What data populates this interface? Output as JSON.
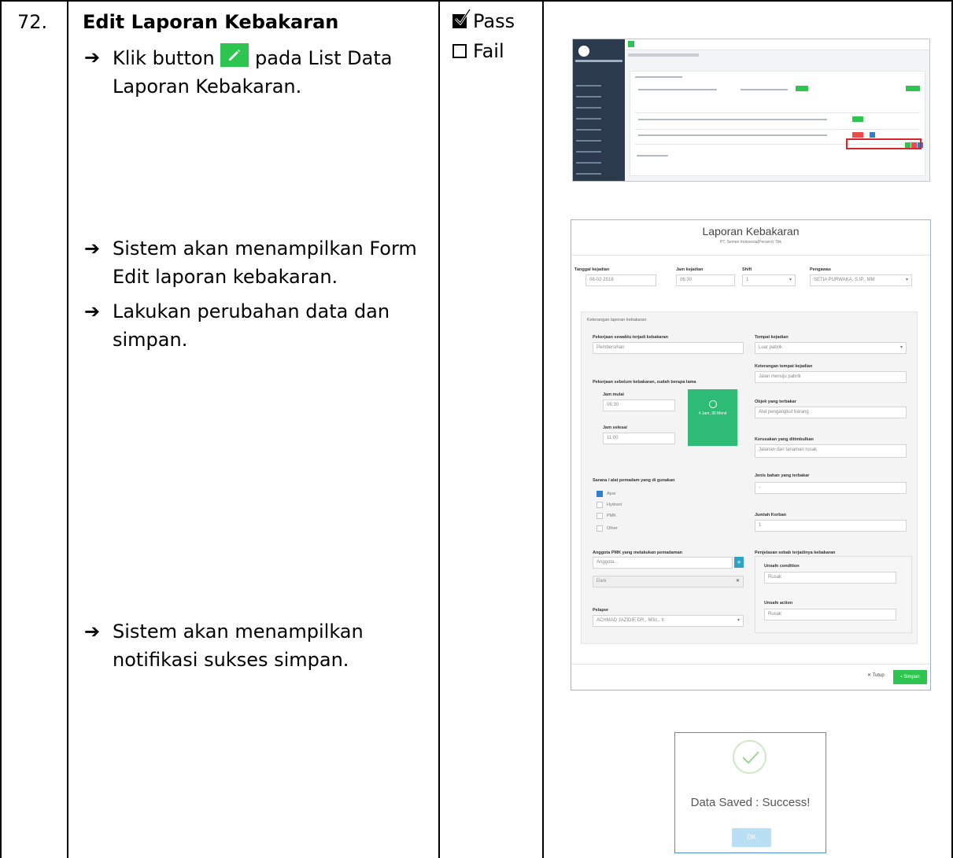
{
  "row": {
    "number": "72.",
    "title": "Edit Laporan Kebakaran",
    "steps": [
      {
        "text_before": "Klik button",
        "text_after": "pada List Data Laporan Kebakaran.",
        "icon": "pencil-icon"
      },
      {
        "text": "Sistem akan menampilkan Form Edit laporan kebakaran."
      },
      {
        "text": "Lakukan perubahan data dan simpan."
      },
      {
        "text": "Sistem akan menampilkan notifikasi sukses simpan."
      }
    ],
    "result": {
      "pass_label": "Pass",
      "fail_label": "Fail",
      "pass_checked": true,
      "fail_checked": false
    }
  },
  "form": {
    "title": "Laporan Kebakaran",
    "subtitle": "PT. Semen Indonesia(Persero) Tbk",
    "fields": {
      "tanggal_label": "Tanggal kejadian",
      "tanggal_value": "08-02-2018",
      "jam_label": "Jam kejadian",
      "jam_value": "06:30",
      "shift_label": "Shift",
      "shift_value": "1",
      "pengawas_label": "Pengawas",
      "pengawas_value": "SETIA PURWAKA, S.IP., MM"
    },
    "section_title": "Keterangan laporan kebakaran",
    "pekerjaan_label": "Pekerjaan sewaktu terjadi kebakaran",
    "pekerjaan_value": "Pembersihan",
    "sebelum_label": "Pekerjaan sebelum kebakaran, sudah berapa lama",
    "jam_mulai_label": "Jam mulai",
    "jam_mulai_value": "06:30",
    "jam_selesai_label": "Jam selesai",
    "jam_selesai_value": "11:00",
    "durasi_text": "4 Jam, 30 Menit",
    "tempat_label": "Tempat kejadian",
    "tempat_value": "Luar pabrik",
    "ket_tempat_label": "Keterangan tempat kejadian",
    "ket_tempat_value": "Jalan menuju pabrik",
    "objek_label": "Objek yang terbakar",
    "objek_value": "Alat pengangkut barang",
    "kerusakan_label": "Kerusakan yang ditimbulkan",
    "kerusakan_value": "Jalanan dan tanaman rusak",
    "sarana_label": "Sarana / alat pemadam yang di gunakan",
    "sarana_items": [
      {
        "label": "Apar",
        "checked": true
      },
      {
        "label": "Hydrant",
        "checked": false
      },
      {
        "label": "PMK",
        "checked": false
      },
      {
        "label": "Other",
        "checked": false
      }
    ],
    "jenis_label": "Jenis bahan yang terbakar",
    "jenis_value": "-",
    "jumlah_label": "Jumlah Korban",
    "jumlah_value": "1",
    "anggota_label": "Anggota PMK yang melakukan pemadaman",
    "anggota_placeholder": "Anggota...",
    "anggota_item": "Dani",
    "penjelasan_label": "Penjelasan sebab terjadinya kebakaran",
    "unsafe_condition_label": "Unsafe condition",
    "unsafe_condition_value": "Rusak",
    "unsafe_action_label": "Unsafe action",
    "unsafe_action_value": "Rusak",
    "pelapor_label": "Pelapor",
    "pelapor_value": "ACHMAD JAZIDIE DR., MSc., Ir.",
    "tutup_label": "Tutup",
    "simpan_label": "Simpan"
  },
  "dialog": {
    "message": "Data Saved : Success!",
    "ok_label": "OK"
  },
  "colors": {
    "accent_green": "#2dc54f",
    "dialog_border": "#4d8fd6",
    "highlight_red": "#d9232d"
  }
}
